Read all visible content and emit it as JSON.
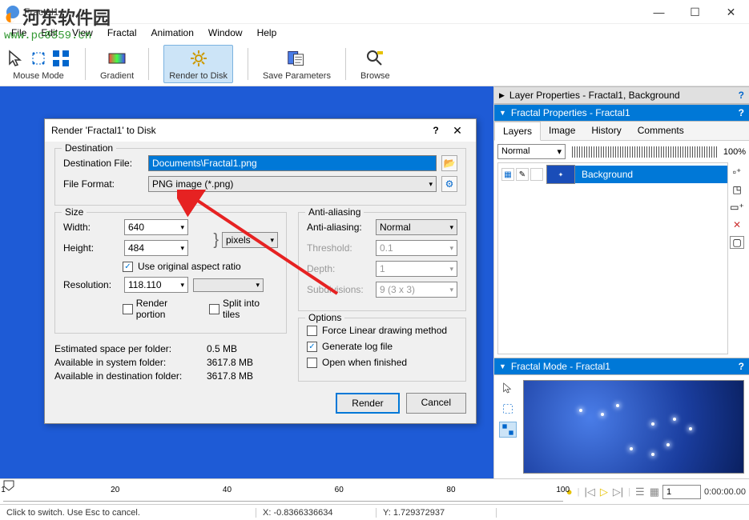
{
  "titlebar": {
    "title": "Fractal1"
  },
  "watermark": {
    "line1": "河东软件园",
    "line2": "www.pc0359.cn"
  },
  "menu": [
    "File",
    "Edit",
    "View",
    "Fractal",
    "Animation",
    "Window",
    "Help"
  ],
  "toolbar": {
    "mouse": "Mouse Mode",
    "gradient": "Gradient",
    "render": "Render to Disk",
    "save": "Save Parameters",
    "browse": "Browse"
  },
  "dialog": {
    "title": "Render 'Fractal1' to Disk",
    "destination": {
      "legend": "Destination",
      "file_label": "Destination File:",
      "file_value": "Documents\\Fractal1.png",
      "format_label": "File Format:",
      "format_value": "PNG image (*.png)"
    },
    "size": {
      "legend": "Size",
      "width_label": "Width:",
      "width_value": "640",
      "height_label": "Height:",
      "height_value": "484",
      "units": "pixels",
      "aspect_label": "Use original aspect ratio",
      "resolution_label": "Resolution:",
      "resolution_value": "118.110",
      "render_portion": "Render portion",
      "split_tiles": "Split into tiles"
    },
    "aa": {
      "legend": "Anti-aliasing",
      "aa_label": "Anti-aliasing:",
      "aa_value": "Normal",
      "threshold_label": "Threshold:",
      "threshold_value": "0.1",
      "depth_label": "Depth:",
      "depth_value": "1",
      "subdiv_label": "Subdivisions:",
      "subdiv_value": "9 (3 x 3)"
    },
    "options": {
      "legend": "Options",
      "linear": "Force Linear drawing method",
      "log": "Generate log file",
      "open": "Open when finished"
    },
    "stats": {
      "est_label": "Estimated space per folder:",
      "est_value": "0.5 MB",
      "sys_label": "Available in system folder:",
      "sys_value": "3617.8 MB",
      "dest_label": "Available in destination folder:",
      "dest_value": "3617.8 MB"
    },
    "buttons": {
      "render": "Render",
      "cancel": "Cancel"
    }
  },
  "panels": {
    "layer_props": "Layer Properties - Fractal1, Background",
    "fractal_props": "Fractal Properties - Fractal1",
    "fractal_mode": "Fractal Mode - Fractal1"
  },
  "tabs": [
    "Layers",
    "Image",
    "History",
    "Comments"
  ],
  "layers": {
    "blend": "Normal",
    "pct": "100%",
    "item": "Background"
  },
  "timeline": {
    "ticks": [
      "1",
      "20",
      "40",
      "60",
      "80",
      "100"
    ],
    "frame": "1",
    "time": "0:00:00.00"
  },
  "statusbar": {
    "hint": "Click to switch. Use Esc to cancel.",
    "x": "X: -0.8366336634",
    "y": "Y: 1.729372937"
  }
}
